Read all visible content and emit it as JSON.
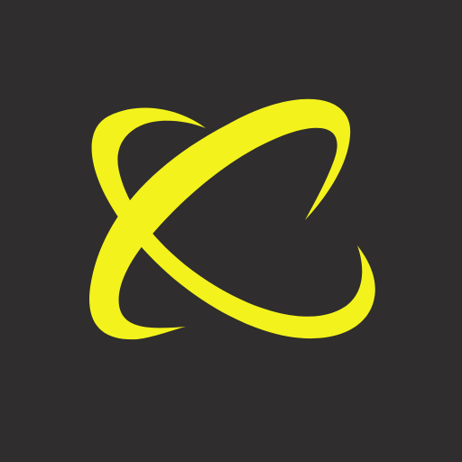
{
  "icon": {
    "name": "orbit-x-logo-icon",
    "background_color": "#2f2d2d",
    "accent_color": "#f3f21c"
  }
}
